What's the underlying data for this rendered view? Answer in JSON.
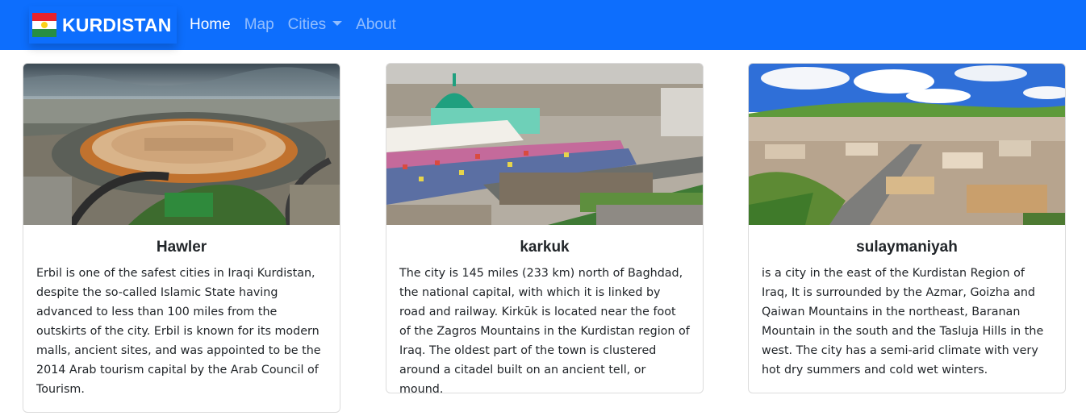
{
  "navbar": {
    "brand": "KURDISTAN",
    "flag_colors": {
      "top": "#e8232b",
      "middle": "#ffffff",
      "bottom": "#278e43",
      "sun": "#fbd116"
    },
    "links": [
      {
        "label": "Home",
        "active": true
      },
      {
        "label": "Map",
        "active": false
      },
      {
        "label": "Cities",
        "active": false,
        "dropdown": true
      },
      {
        "label": "About",
        "active": false
      }
    ],
    "background": "#0d6efd"
  },
  "cards": [
    {
      "title": "Hawler",
      "image": "erbil-citadel-aerial-photo",
      "text": "Erbil is one of the safest cities in Iraqi Kurdistan, despite the so-called Islamic State having advanced to less than 100 miles from the outskirts of the city. Erbil is known for its modern malls, ancient sites, and was appointed to be the 2014 Arab tourism capital by the Arab Council of Tourism."
    },
    {
      "title": "karkuk",
      "image": "kirkuk-market-mosque-photo",
      "text": "The city is 145 miles (233 km) north of Baghdad, the national capital, with which it is linked by road and railway. Kirkūk is located near the foot of the Zagros Mountains in the Kurdistan region of Iraq. The oldest part of the town is clustered around a citadel built on an ancient tell, or mound."
    },
    {
      "title": "sulaymaniyah",
      "image": "sulaymaniyah-city-aerial-photo",
      "text": "is a city in the east of the Kurdistan Region of Iraq, It is surrounded by the Azmar, Goizha and Qaiwan Mountains in the northeast, Baranan Mountain in the south and the Tasluja Hills in the west. The city has a semi-arid climate with very hot dry summers and cold wet winters."
    }
  ]
}
